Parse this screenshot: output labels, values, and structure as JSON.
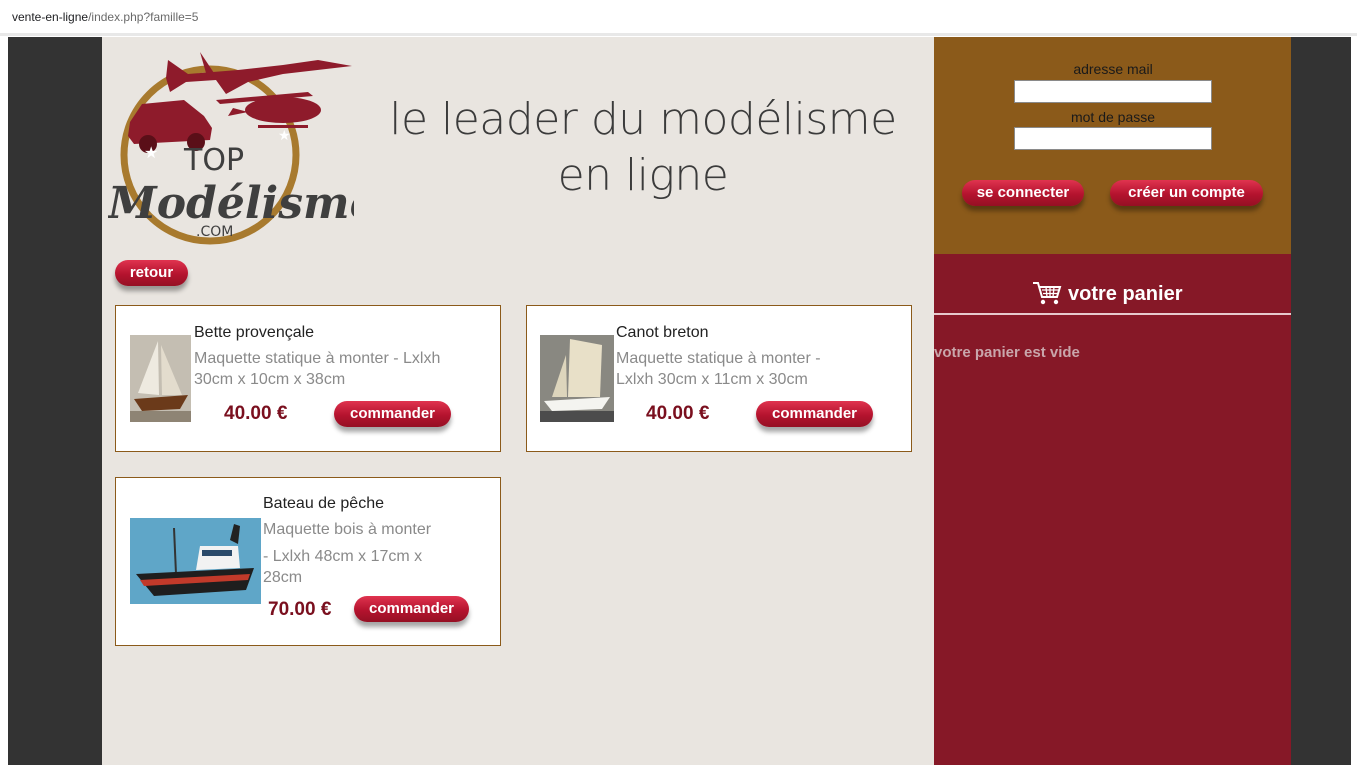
{
  "browser": {
    "url_host": "vente-en-ligne",
    "url_path": "/index.php?famille=5"
  },
  "header": {
    "tagline": "le leader du modélisme en ligne",
    "logo_text_top": "TOP",
    "logo_text_main": "Modélisme",
    "logo_text_sub": ".COM"
  },
  "nav": {
    "back_label": "retour"
  },
  "login": {
    "email_label": "adresse mail",
    "email_value": "",
    "password_label": "mot de passe",
    "password_value": "",
    "connect_label": "se connecter",
    "create_account_label": "créer un compte"
  },
  "basket": {
    "title": "votre panier",
    "icon": "cart-icon",
    "empty_text": "votre panier est vide"
  },
  "products": [
    {
      "name": "Bette provençale",
      "desc_line1": "Maquette statique à monter - Lxlxh",
      "desc_line2": "30cm x 10cm x 38cm",
      "desc_line3": "",
      "desc_line4": "",
      "price": "40.00 €",
      "order_label": "commander"
    },
    {
      "name": "Canot breton",
      "desc_line1": "Maquette statique à monter -",
      "desc_line2": "Lxlxh 30cm x 11cm x 30cm",
      "desc_line3": "",
      "desc_line4": "",
      "price": "40.00 €",
      "order_label": "commander"
    },
    {
      "name": "Bateau de pêche",
      "desc_line1": "Maquette bois à monter",
      "desc_line2": "- Lxlxh 48cm x 17cm x",
      "desc_line3": "28cm",
      "desc_line4": "",
      "price": "70.00 €",
      "order_label": "commander"
    }
  ],
  "colors": {
    "main_bg": "#e9e5e0",
    "login_panel": "#8b5a1a",
    "basket_panel": "#861827",
    "button": "#b4132e",
    "price": "#7a0f1e",
    "outer": "#333333"
  }
}
